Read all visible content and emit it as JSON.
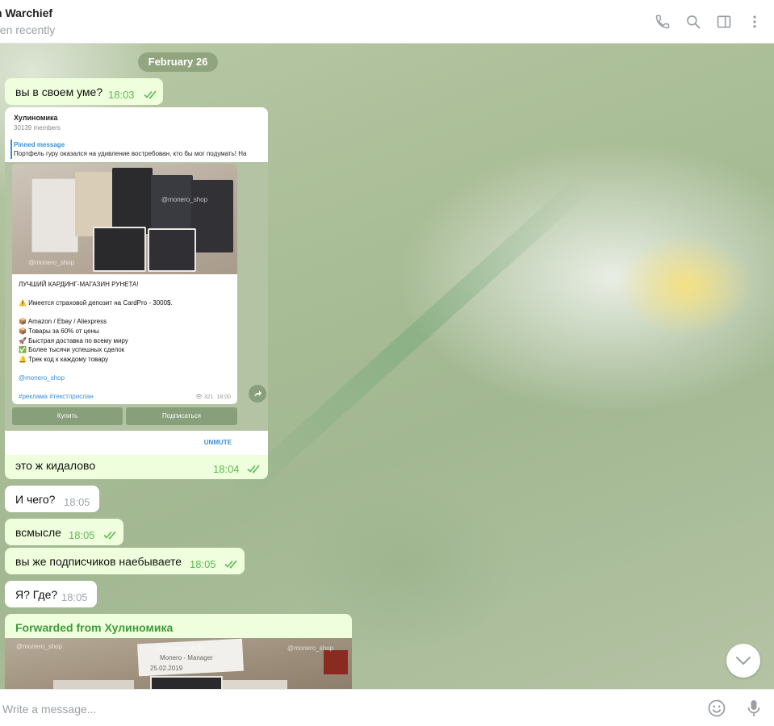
{
  "header": {
    "chat_name": "n Warchief",
    "status": "een recently",
    "icons": [
      "phone-icon",
      "search-icon",
      "sidebar-toggle-icon",
      "more-vertical-icon"
    ]
  },
  "chat": {
    "date_divider": "February 26",
    "messages": [
      {
        "direction": "out",
        "text": "вы в своем уме?",
        "time": "18:03",
        "read": true
      },
      {
        "direction": "out",
        "text": "это ж кидалово",
        "time": "18:04",
        "read": true
      },
      {
        "direction": "in",
        "text": "И чего?",
        "time": "18:05"
      },
      {
        "direction": "out",
        "text": "всмысле",
        "time": "18:05",
        "read": true
      },
      {
        "direction": "out",
        "text": "вы же подписчиков наебываете",
        "time": "18:05",
        "read": true
      },
      {
        "direction": "in",
        "text": "Я? Где?",
        "time": "18:05"
      }
    ],
    "screenshot": {
      "channel_title": "Хулиномика",
      "members": "30139 members",
      "pinned_label": "Pinned message",
      "pinned_text": "Портфель гуру оказался на удивление востребован, кто бы мог подумать! На",
      "post_lines": [
        "ЛУЧШИЙ КАРДИНГ-МАГАЗИН РУНЕТА!",
        "",
        "⚠️ Имеется страховой депозит на CardPro - 3000$.",
        "",
        "📦 Amazon / Ebay / Aliexpress",
        "📦 Товары за 60% от цены",
        "🚀 Быстрая доставка по всему миру",
        "✅ Более тысячи успешных сделок",
        "🔔 Трек код к каждому товару"
      ],
      "post_link": "@monero_shop",
      "post_tags": "#реклама #текстприслан",
      "views": "321",
      "time": "18:00",
      "button_buy": "Купить",
      "button_subscribe": "Подписаться",
      "unmute": "UNMUTE",
      "watermark": "@monero_shop"
    },
    "forwarded": {
      "label": "Forwarded from Хулиномика",
      "watermark": "@monero_shop",
      "note_line1": "Monero - Manager",
      "note_line2": "25.02.2019"
    }
  },
  "composer": {
    "placeholder": "Write a message...",
    "icons": [
      "emoji-icon",
      "microphone-icon"
    ]
  },
  "colors": {
    "outgoing_bubble": "#effedd",
    "incoming_bubble": "#ffffff",
    "time_green": "#5fb955",
    "forward_green": "#3e9a3a",
    "link_blue": "#3a8fd6"
  }
}
